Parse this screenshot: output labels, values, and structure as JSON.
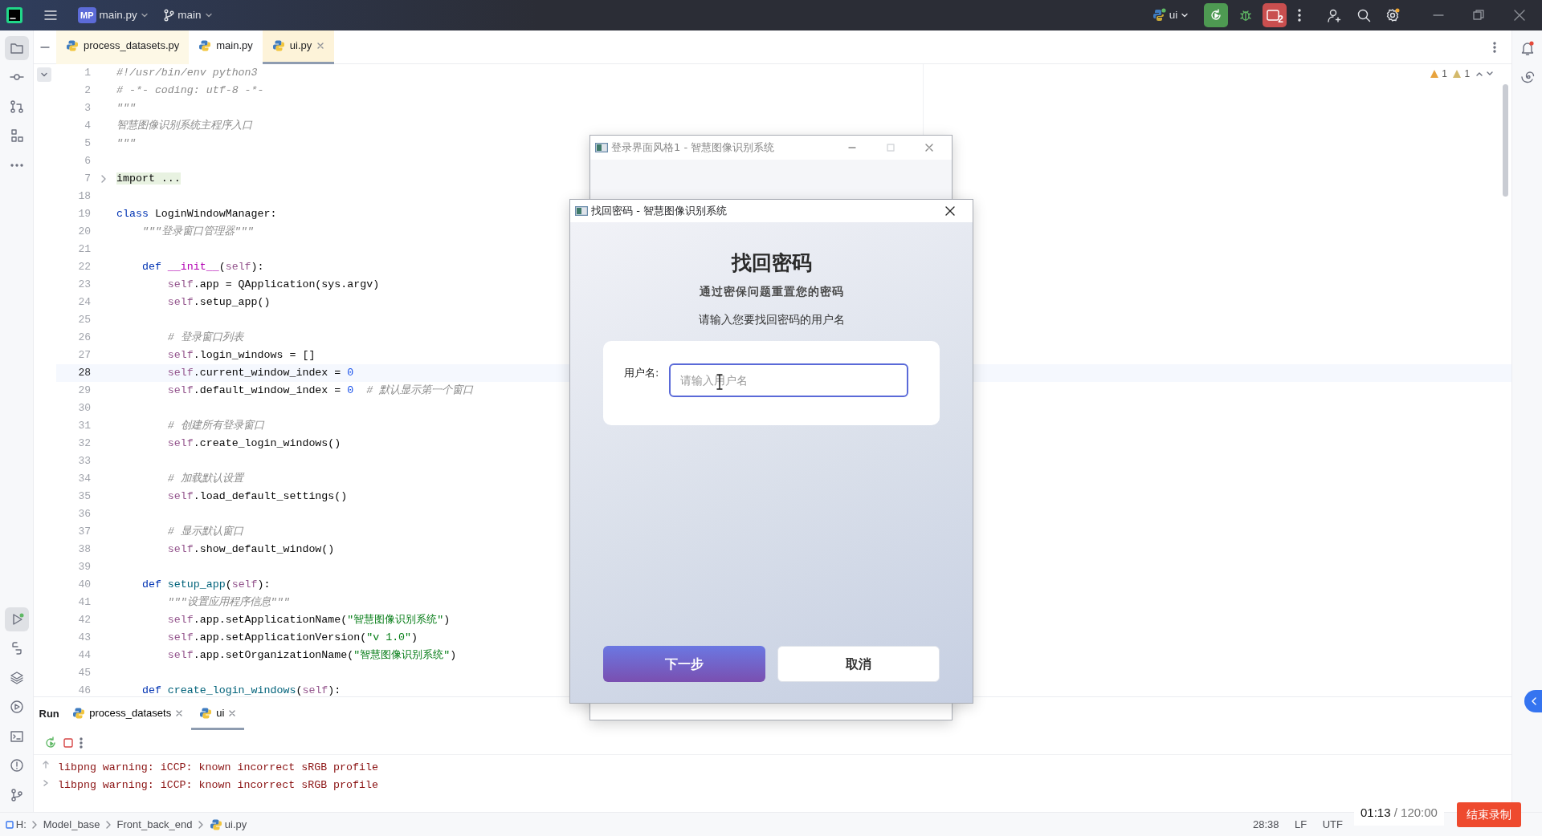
{
  "title_bar": {
    "project_badge": "MP",
    "project": "main.py",
    "branch": "main",
    "run_config": "ui",
    "stop_count": "2"
  },
  "editor_tabs": [
    {
      "label": "process_datasets.py",
      "selected": false,
      "closable": false
    },
    {
      "label": "main.py",
      "selected": false,
      "closable": false
    },
    {
      "label": "ui.py",
      "selected": true,
      "closable": true
    }
  ],
  "editor": {
    "inspections": [
      "1",
      "1"
    ],
    "lines": [
      {
        "number": "1",
        "current": false,
        "segments": [
          {
            "kind": "comment",
            "text": "#!/usr/bin/env python3"
          }
        ]
      },
      {
        "number": "2",
        "current": false,
        "segments": [
          {
            "kind": "comment",
            "text": "# -*- coding: utf-8 -*-"
          }
        ]
      },
      {
        "number": "3",
        "current": false,
        "segments": [
          {
            "kind": "comment",
            "text": "\"\"\""
          }
        ]
      },
      {
        "number": "4",
        "current": false,
        "segments": [
          {
            "kind": "comment",
            "text": "智慧图像识别系统主程序入口"
          }
        ]
      },
      {
        "number": "5",
        "current": false,
        "segments": [
          {
            "kind": "comment",
            "text": "\"\"\""
          }
        ]
      },
      {
        "number": "6",
        "current": false
      },
      {
        "number": "7",
        "current": false,
        "folded": true,
        "segments": [
          {
            "kind": "folded",
            "text": "import ..."
          }
        ]
      },
      {
        "number": "18",
        "current": false
      },
      {
        "number": "19",
        "current": false,
        "segments": [
          {
            "kind": "keyword",
            "text": "class"
          },
          {
            "kind": "plain",
            "text": " LoginWindowManager:"
          }
        ]
      },
      {
        "number": "20",
        "current": false,
        "segments": [
          {
            "kind": "comment",
            "text": "    \"\"\"登录窗口管理器\"\"\""
          }
        ]
      },
      {
        "number": "21",
        "current": false
      },
      {
        "number": "22",
        "current": false,
        "segments": [
          {
            "kind": "keyword",
            "text": "    def "
          },
          {
            "kind": "dunder",
            "text": "__init__"
          },
          {
            "kind": "plain",
            "text": "("
          },
          {
            "kind": "self",
            "text": "self"
          },
          {
            "kind": "plain",
            "text": "):"
          }
        ]
      },
      {
        "number": "23",
        "current": false,
        "segments": [
          {
            "kind": "self",
            "text": "        self"
          },
          {
            "kind": "plain",
            "text": ".app = QApplication(sys.argv)"
          }
        ]
      },
      {
        "number": "24",
        "current": false,
        "segments": [
          {
            "kind": "self",
            "text": "        self"
          },
          {
            "kind": "plain",
            "text": ".setup_app()"
          }
        ]
      },
      {
        "number": "25",
        "current": false
      },
      {
        "number": "26",
        "current": false,
        "segments": [
          {
            "kind": "comment",
            "text": "        # 登录窗口列表"
          }
        ]
      },
      {
        "number": "27",
        "current": false,
        "segments": [
          {
            "kind": "self",
            "text": "        self"
          },
          {
            "kind": "plain",
            "text": ".login_windows = []"
          }
        ]
      },
      {
        "number": "28",
        "current": true,
        "segments": [
          {
            "kind": "self",
            "text": "        self"
          },
          {
            "kind": "plain",
            "text": ".current_window_index = "
          },
          {
            "kind": "number",
            "text": "0"
          }
        ]
      },
      {
        "number": "29",
        "current": false,
        "segments": [
          {
            "kind": "self",
            "text": "        self"
          },
          {
            "kind": "plain",
            "text": ".default_window_index = "
          },
          {
            "kind": "number",
            "text": "0"
          },
          {
            "kind": "comment",
            "text": "  # 默认显示第一个窗口"
          }
        ]
      },
      {
        "number": "30",
        "current": false
      },
      {
        "number": "31",
        "current": false,
        "segments": [
          {
            "kind": "comment",
            "text": "        # 创建所有登录窗口"
          }
        ]
      },
      {
        "number": "32",
        "current": false,
        "segments": [
          {
            "kind": "self",
            "text": "        self"
          },
          {
            "kind": "plain",
            "text": ".create_login_windows()"
          }
        ]
      },
      {
        "number": "33",
        "current": false
      },
      {
        "number": "34",
        "current": false,
        "segments": [
          {
            "kind": "comment",
            "text": "        # 加载默认设置"
          }
        ]
      },
      {
        "number": "35",
        "current": false,
        "segments": [
          {
            "kind": "self",
            "text": "        self"
          },
          {
            "kind": "plain",
            "text": ".load_default_settings()"
          }
        ]
      },
      {
        "number": "36",
        "current": false
      },
      {
        "number": "37",
        "current": false,
        "segments": [
          {
            "kind": "comment",
            "text": "        # 显示默认窗口"
          }
        ]
      },
      {
        "number": "38",
        "current": false,
        "segments": [
          {
            "kind": "self",
            "text": "        self"
          },
          {
            "kind": "plain",
            "text": ".show_default_window()"
          }
        ]
      },
      {
        "number": "39",
        "current": false
      },
      {
        "number": "40",
        "current": false,
        "segments": [
          {
            "kind": "keyword",
            "text": "    def "
          },
          {
            "kind": "function",
            "text": "setup_app"
          },
          {
            "kind": "plain",
            "text": "("
          },
          {
            "kind": "self",
            "text": "self"
          },
          {
            "kind": "plain",
            "text": "):"
          }
        ]
      },
      {
        "number": "41",
        "current": false,
        "segments": [
          {
            "kind": "comment",
            "text": "        \"\"\"设置应用程序信息\"\"\""
          }
        ]
      },
      {
        "number": "42",
        "current": false,
        "segments": [
          {
            "kind": "self",
            "text": "        self"
          },
          {
            "kind": "plain",
            "text": ".app.setApplicationName("
          },
          {
            "kind": "string",
            "text": "\"智慧图像识别系统\""
          },
          {
            "kind": "plain",
            "text": ")"
          }
        ]
      },
      {
        "number": "43",
        "current": false,
        "segments": [
          {
            "kind": "self",
            "text": "        self"
          },
          {
            "kind": "plain",
            "text": ".app.setApplicationVersion("
          },
          {
            "kind": "string",
            "text": "\"v 1.0\""
          },
          {
            "kind": "plain",
            "text": ")"
          }
        ]
      },
      {
        "number": "44",
        "current": false,
        "segments": [
          {
            "kind": "self",
            "text": "        self"
          },
          {
            "kind": "plain",
            "text": ".app.setOrganizationName("
          },
          {
            "kind": "string",
            "text": "\"智慧图像识别系统\""
          },
          {
            "kind": "plain",
            "text": ")"
          }
        ]
      },
      {
        "number": "45",
        "current": false
      },
      {
        "number": "46",
        "current": false,
        "segments": [
          {
            "kind": "keyword",
            "text": "    def "
          },
          {
            "kind": "function",
            "text": "create_login_windows"
          },
          {
            "kind": "plain",
            "text": "("
          },
          {
            "kind": "self",
            "text": "self"
          },
          {
            "kind": "plain",
            "text": "):"
          }
        ]
      }
    ]
  },
  "login_window": {
    "title": "登录界面风格1 - 智慧图像识别系统"
  },
  "reset_dialog": {
    "title": "找回密码 - 智慧图像识别系统",
    "heading": "找回密码",
    "subtitle": "通过密保问题重置您的密码",
    "prompt": "请输入您要找回密码的用户名",
    "username_field": {
      "label": "用户名:",
      "placeholder": "请输入用户名",
      "focused": true
    },
    "buttons": [
      {
        "label": "下一步",
        "kind": "primary"
      },
      {
        "label": "取消",
        "kind": "secondary"
      }
    ]
  },
  "run_panel": {
    "title": "Run",
    "tabs": [
      {
        "label": "process_datasets",
        "selected": false
      },
      {
        "label": "ui",
        "selected": true
      }
    ],
    "output": [
      "libpng warning: iCCP: known incorrect sRGB profile",
      "libpng warning: iCCP: known incorrect sRGB profile"
    ]
  },
  "status_bar": {
    "breadcrumbs": [
      "H:",
      "Model_base",
      "Front_back_end",
      "ui.py"
    ],
    "position": "28:38",
    "line_ending": "LF",
    "encoding": "UTF"
  },
  "recording": {
    "elapsed": "01:13",
    "limit": "/ 120:00",
    "stop_label": "结束录制"
  }
}
